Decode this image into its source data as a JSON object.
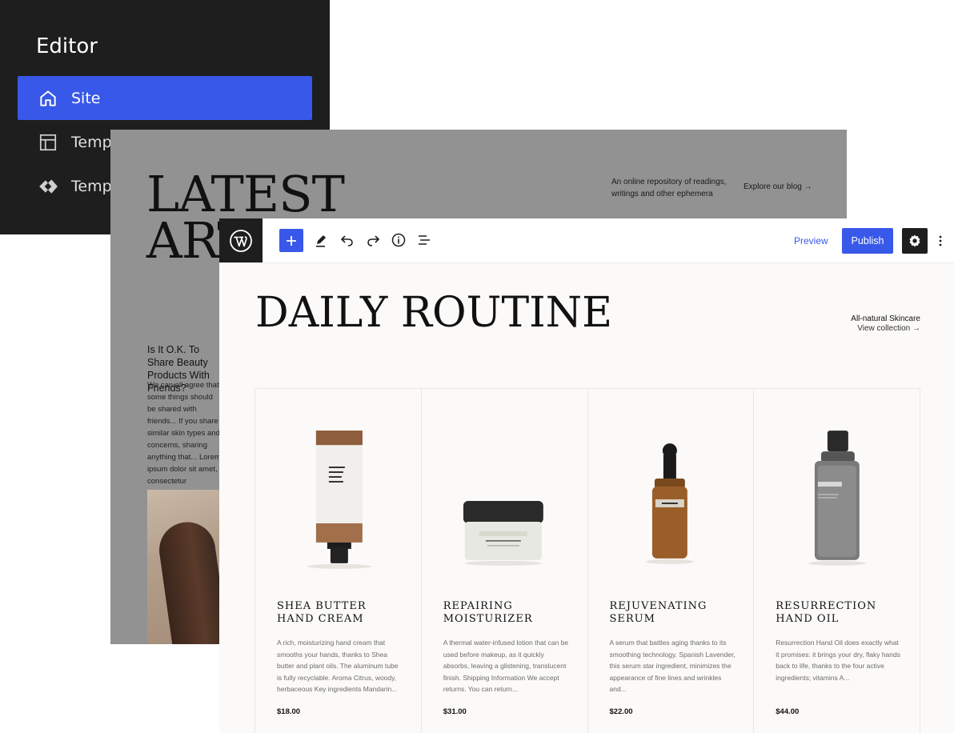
{
  "sidebar": {
    "title": "Editor",
    "items": [
      {
        "label": "Site",
        "icon": "home-icon",
        "active": true
      },
      {
        "label": "Templates",
        "icon": "layout-icon",
        "active": false
      },
      {
        "label": "Template Parts",
        "icon": "symbol-icon",
        "active": false
      }
    ]
  },
  "blog_template": {
    "heading_line1": "LATEST",
    "heading_line2": "ARTICLES",
    "tagline": "An online repository of readings, writings and other ephemera",
    "explore_link": "Explore our blog →",
    "post_title": "Is It O.K. To Share Beauty Products With Friends?",
    "post_excerpt": "We can all agree that some things should be shared with friends... If you share similar skin types and concerns, sharing anything that... Lorem ipsum dolor sit amet, consectetur adipiscing elit, sed do eiusmod tempor ut labora et dolore magna"
  },
  "toolbar": {
    "logo": "wordpress-icon",
    "preview_label": "Preview",
    "publish_label": "Publish"
  },
  "page": {
    "title": "DAILY ROUTINE",
    "collection_kicker": "All-natural Skincare",
    "collection_link": "View collection →"
  },
  "products": [
    {
      "name_line1": "SHEA BUTTER",
      "name_line2": "HAND CREAM",
      "description": "A rich, moisturizing hand cream that smooths your hands, thanks to Shea butter and plant oils. The aluminum tube is fully recyclable. Aroma Citrus, woody, herbaceous Key ingredients Mandarin...",
      "price": "$18.00",
      "image": "tube"
    },
    {
      "name_line1": "REPAIRING",
      "name_line2": "MOISTURIZER",
      "description": "A thermal water-infused lotion that can be used before makeup, as it quickly absorbs, leaving a glistening, translucent finish. Shipping Information We accept returns. You can return...",
      "price": "$31.00",
      "image": "jar"
    },
    {
      "name_line1": "REJUVENATING",
      "name_line2": "SERUM",
      "description": "A serum that battles aging thanks to its smoothing technology. Spanish Lavender, this serum star ingredient, minimizes the appearance of fine lines and wrinkles and...",
      "price": "$22.00",
      "image": "dropper"
    },
    {
      "name_line1": "RESURRECTION",
      "name_line2": "HAND OIL",
      "description": "Resurrection Hand Oil does exactly what it promises: it brings your dry, flaky hands back to life, thanks to the four active ingredients; vitamins A...",
      "price": "$44.00",
      "image": "bottle"
    }
  ],
  "colors": {
    "accent": "#3858e9",
    "dark": "#1e1e1e",
    "blog_bg": "#929292",
    "editor_bg": "#fbfaf8"
  }
}
